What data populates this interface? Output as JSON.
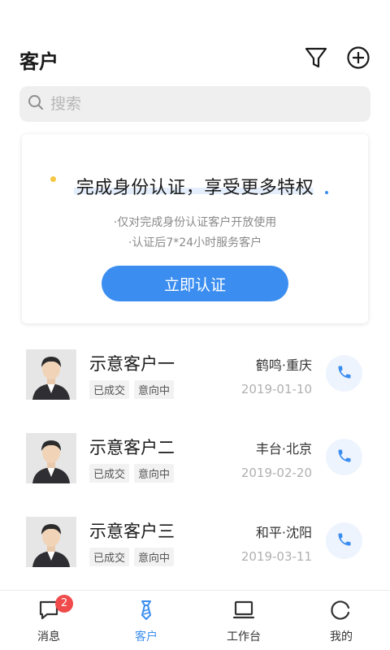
{
  "header": {
    "title": "客户",
    "filter_icon": "filter-icon",
    "add_icon": "plus-circle-icon"
  },
  "search": {
    "placeholder": "搜索",
    "icon": "search-icon"
  },
  "promo": {
    "title": "完成身份认证，享受更多特权",
    "line1": "·仅对完成身份认证客户开放使用",
    "line2": "·认证后7*24小时服务客户",
    "button": "立即认证",
    "accent_color": "#3B8EF0"
  },
  "customers": [
    {
      "name": "示意客户一",
      "tags": [
        "已成交",
        "意向中"
      ],
      "location": "鹤鸣·重庆",
      "date": "2019-01-10"
    },
    {
      "name": "示意客户二",
      "tags": [
        "已成交",
        "意向中"
      ],
      "location": "丰台·北京",
      "date": "2019-02-20"
    },
    {
      "name": "示意客户三",
      "tags": [
        "已成交",
        "意向中"
      ],
      "location": "和平·沈阳",
      "date": "2019-03-11"
    }
  ],
  "tabs": [
    {
      "label": "消息",
      "icon": "message-icon",
      "badge": "2",
      "active": false
    },
    {
      "label": "客户",
      "icon": "tie-icon",
      "active": true
    },
    {
      "label": "工作台",
      "icon": "laptop-icon",
      "active": false
    },
    {
      "label": "我的",
      "icon": "profile-icon",
      "active": false
    }
  ]
}
